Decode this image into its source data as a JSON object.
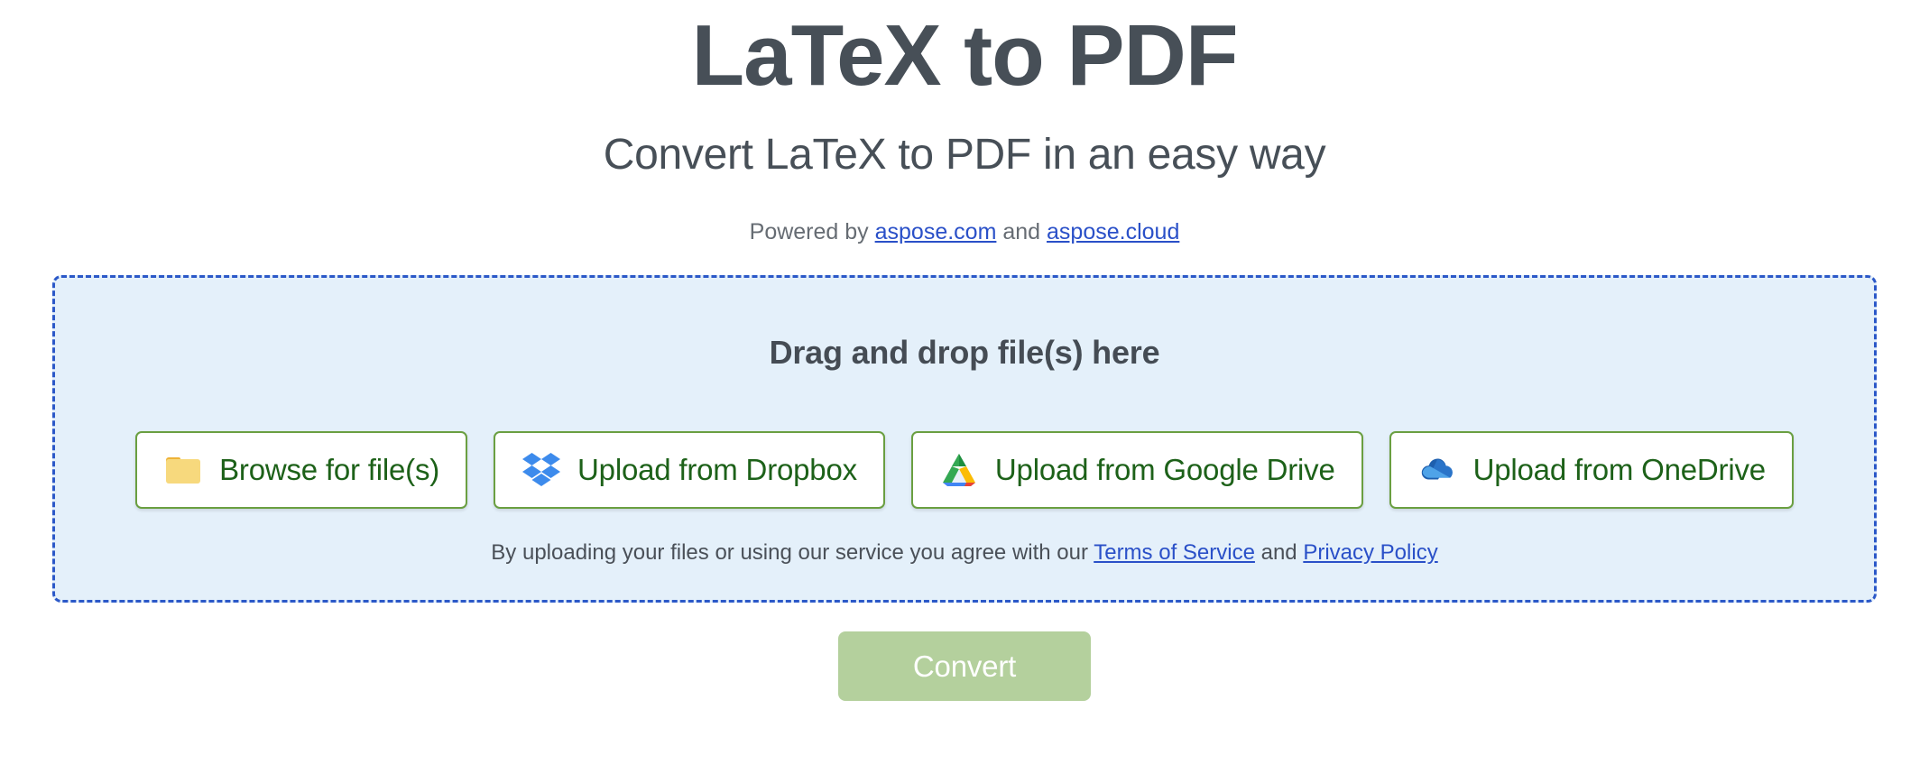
{
  "header": {
    "title": "LaTeX to PDF",
    "subtitle": "Convert LaTeX to PDF in an easy way",
    "powered_prefix": "Powered by ",
    "powered_link1": "aspose.com",
    "powered_middle": " and ",
    "powered_link2": "aspose.cloud"
  },
  "dropzone": {
    "heading": "Drag and drop file(s) here",
    "buttons": [
      {
        "label": "Browse for file(s)",
        "icon": "folder-icon"
      },
      {
        "label": "Upload from Dropbox",
        "icon": "dropbox-icon"
      },
      {
        "label": "Upload from Google Drive",
        "icon": "google-drive-icon"
      },
      {
        "label": "Upload from OneDrive",
        "icon": "onedrive-icon"
      }
    ],
    "terms_prefix": "By uploading your files or using our service you agree with our ",
    "terms_link1": "Terms of Service",
    "terms_middle": " and ",
    "terms_link2": "Privacy Policy"
  },
  "actions": {
    "convert_label": "Convert"
  },
  "colors": {
    "page_background": "#ffffff",
    "heading_text": "#474f57",
    "link_blue": "#2a50c8",
    "dropzone_fill": "#e4f0fa",
    "dropzone_border": "#2b58c8",
    "button_border_green": "#6a9f41",
    "button_text_green": "#1d6119",
    "convert_disabled_green": "#b4d09d"
  }
}
